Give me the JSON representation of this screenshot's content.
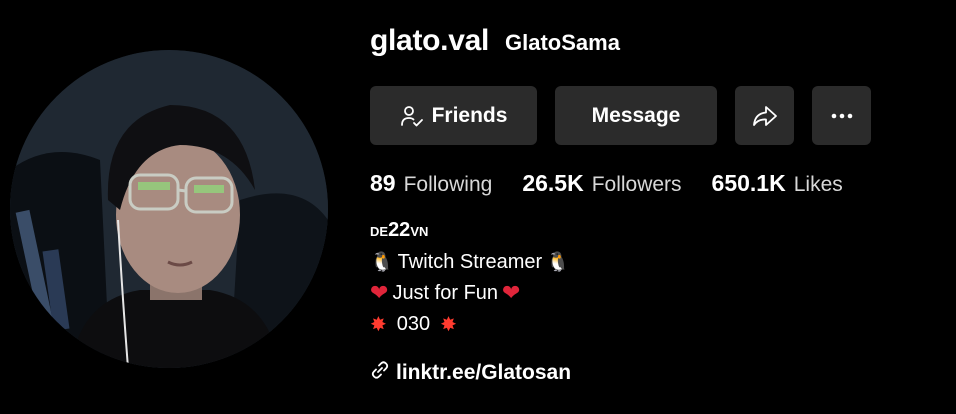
{
  "profile": {
    "username": "glato.val",
    "nickname": "GlatoSama"
  },
  "actions": {
    "friends_label": "Friends",
    "message_label": "Message",
    "share_icon": "share-icon",
    "more_icon": "more-icon"
  },
  "stats": [
    {
      "value": "89",
      "label": "Following"
    },
    {
      "value": "26.5K",
      "label": "Followers"
    },
    {
      "value": "650.1K",
      "label": "Likes"
    }
  ],
  "bio": {
    "handle_prefix": "DE",
    "handle_number": "22",
    "handle_suffix": "VN",
    "line1_text": "Twitch Streamer",
    "line1_emoji": "🐧",
    "line2_text": "Just for Fun",
    "line2_emoji": "❤",
    "line3_text": "030",
    "line3_emoji": "✸"
  },
  "link": {
    "text": "linktr.ee/Glatosan",
    "icon": "link-icon"
  }
}
